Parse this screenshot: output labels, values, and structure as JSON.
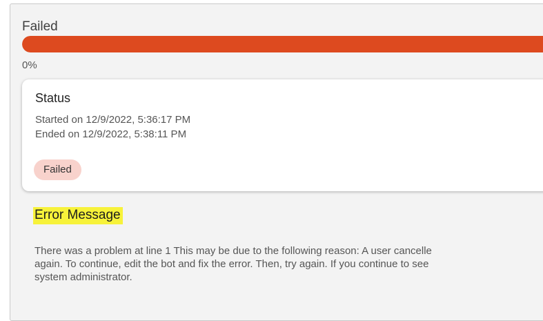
{
  "progress": {
    "label": "Failed",
    "percent_text": "0%",
    "fill_fraction": 1.0,
    "bar_color": "#dd4a1f"
  },
  "status": {
    "title": "Status",
    "started": "Started on 12/9/2022, 5:36:17 PM",
    "ended": "Ended on 12/9/2022, 5:38:11 PM",
    "badge": "Failed",
    "badge_color": "#f8d2cc"
  },
  "error": {
    "heading": "Error Message",
    "highlight_color": "#f7f23a",
    "lines": [
      "There was a problem at line 1 This may be due to the following reason: A user cancelle",
      "again. To continue, edit the bot and fix the error. Then, try again. If you continue to see",
      "system administrator."
    ]
  }
}
